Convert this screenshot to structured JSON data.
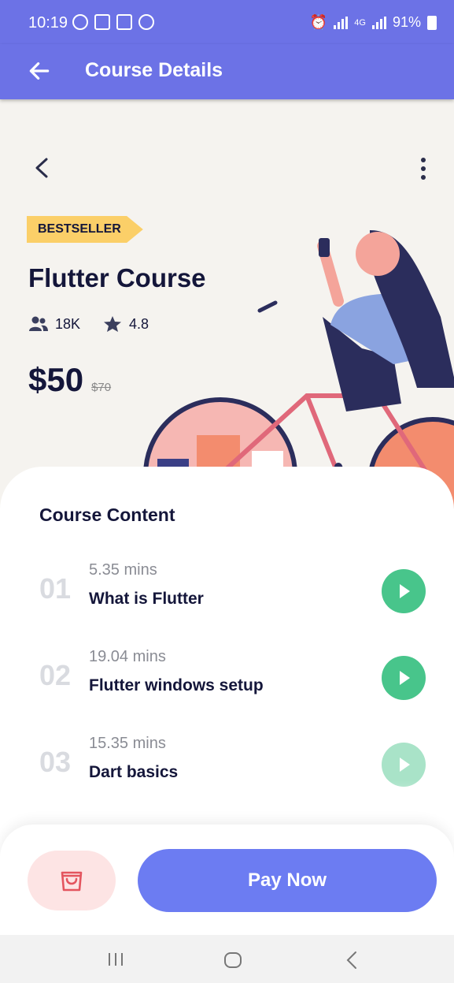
{
  "status": {
    "time": "10:19",
    "network": "4G",
    "battery": "91%"
  },
  "appbar": {
    "title": "Course Details"
  },
  "hero": {
    "badge": "BESTSELLER",
    "course_title": "Flutter Course",
    "students": "18K",
    "rating": "4.8",
    "price": "$50",
    "old_price": "$70"
  },
  "content": {
    "section_title": "Course Content",
    "lessons": [
      {
        "number": "01",
        "duration": "5.35 mins",
        "title": "What is Flutter"
      },
      {
        "number": "02",
        "duration": "19.04 mins",
        "title": "Flutter windows setup"
      },
      {
        "number": "03",
        "duration": "15.35 mins",
        "title": "Dart basics"
      }
    ]
  },
  "footer": {
    "pay_label": "Pay Now"
  },
  "colors": {
    "primary": "#6c72e6",
    "button": "#6c7cf2",
    "play": "#48c58b",
    "badge": "#fbcf68",
    "cart_bg": "#fde4e4",
    "cart_icon": "#e4555f"
  },
  "icons": {
    "appbar_back": "arrow-left-icon",
    "hero_back": "chevron-left-icon",
    "hero_more": "more-vertical-icon",
    "students": "users-icon",
    "rating": "star-icon",
    "play": "play-icon",
    "cart": "shopping-bag-icon"
  }
}
